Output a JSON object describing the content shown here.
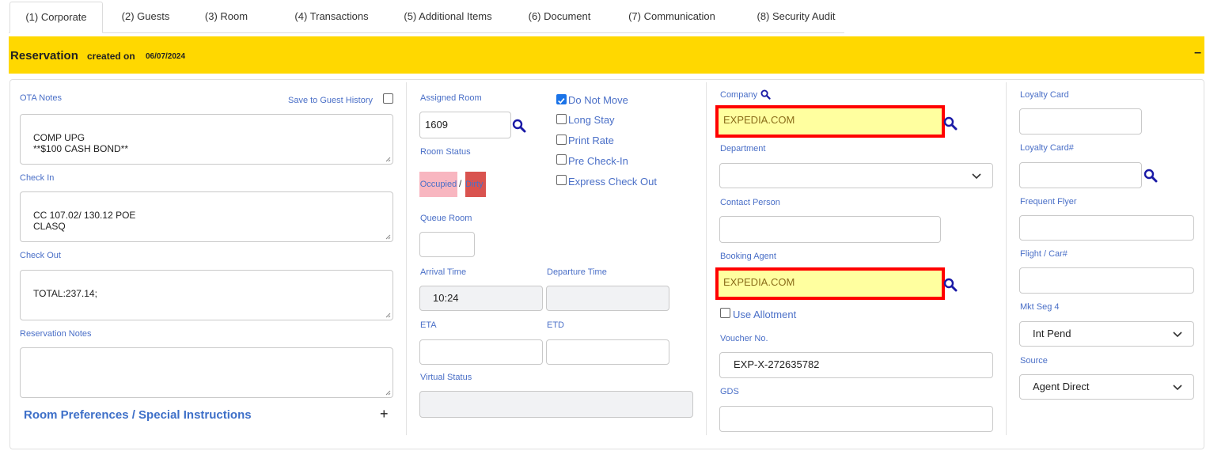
{
  "tabs": [
    {
      "label": "(1) Corporate"
    },
    {
      "label": "(2) Guests"
    },
    {
      "label": "(3) Room"
    },
    {
      "label": "(4) Transactions"
    },
    {
      "label": "(5) Additional Items"
    },
    {
      "label": "(6) Document"
    },
    {
      "label": "(7) Communication"
    },
    {
      "label": "(8) Security Audit"
    }
  ],
  "header": {
    "title": "Reservation",
    "created_label": "created on",
    "created_date": "06/07/2024",
    "collapse_symbol": "–"
  },
  "notes": {
    "ota_label": "OTA Notes",
    "save_history_label": "Save to Guest History",
    "ota_value": "COMP UPG\n**$100 CASH BOND**",
    "checkin_label": "Check In",
    "checkin_value": "CC 107.02/ 130.12 POE\nCLASQ",
    "checkout_label": "Check Out",
    "checkout_value": "TOTAL:237.14;",
    "resnotes_label": "Reservation Notes",
    "resnotes_value": "",
    "preferences_label": "Room Preferences / Special Instructions",
    "preferences_toggle": "+"
  },
  "room": {
    "assigned_label": "Assigned Room",
    "assigned_value": "1609",
    "status_label": "Room Status",
    "status_occupied": "Occupied",
    "status_sep": "/",
    "status_dirty": "Dirty",
    "queue_label": "Queue Room",
    "queue_value": "",
    "arrival_label": "Arrival Time",
    "arrival_value": "10:24",
    "departure_label": "Departure Time",
    "departure_value": "",
    "eta_label": "ETA",
    "etd_label": "ETD",
    "virtual_label": "Virtual Status"
  },
  "options": {
    "do_not_move": {
      "label": "Do Not Move",
      "checked": true
    },
    "long_stay": {
      "label": "Long Stay",
      "checked": false
    },
    "print_rate": {
      "label": "Print Rate",
      "checked": false
    },
    "pre_checkin": {
      "label": "Pre Check-In",
      "checked": false
    },
    "express_checkout": {
      "label": "Express Check Out",
      "checked": false
    }
  },
  "company": {
    "company_label": "Company",
    "company_value": "EXPEDIA.COM",
    "department_label": "Department",
    "department_value": "",
    "contact_label": "Contact Person",
    "booking_label": "Booking Agent",
    "booking_value": "EXPEDIA.COM",
    "allotment_label": "Use Allotment",
    "voucher_label": "Voucher No.",
    "voucher_value": "EXP-X-272635782",
    "gds_label": "GDS"
  },
  "loyalty": {
    "card_label": "Loyalty Card",
    "cardno_label": "Loyalty Card#",
    "flyer_label": "Frequent Flyer",
    "flight_label": "Flight / Car#",
    "mktseg_label": "Mkt Seg 4",
    "mktseg_value": "Int Pend",
    "source_label": "Source",
    "source_value": "Agent Direct"
  },
  "colors": {
    "header_bg": "#ffd800",
    "label_blue": "#4a6fc7",
    "highlight_border": "#ff0000",
    "highlight_fill": "#ffff9f",
    "occupied": "#f8b6c0",
    "dirty": "#d9534f",
    "search_icon": "#1a1aa6"
  }
}
